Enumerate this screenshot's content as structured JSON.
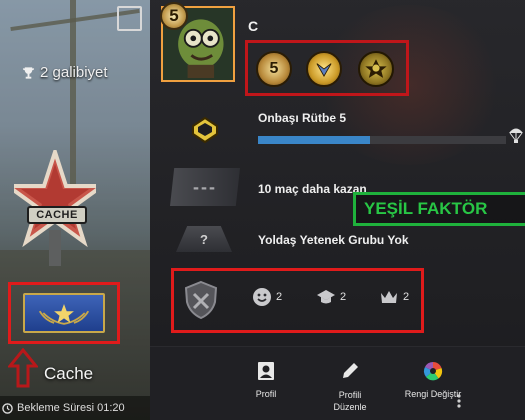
{
  "left_panel": {
    "wins_text": "2 galibiyet",
    "map_badge_text": "CACHE",
    "map_name": "Cache",
    "wait_label": "Bekleme Süresi 01:20"
  },
  "profile": {
    "level": "5",
    "username": "C",
    "rank_name": "Onbaşı Rütbe 5",
    "xp_progress": 0.45,
    "wins_placeholder": "---",
    "wins_needed_text": "10 maç daha kazan",
    "skill_placeholder": "?",
    "skill_group_text": "Yoldaş Yetenek Grubu Yok",
    "annotation_text": "YEŞİL FAKTÖR",
    "coin_labels": [
      "5",
      "",
      ""
    ],
    "commends": [
      {
        "icon": "smile-icon",
        "count": "2"
      },
      {
        "icon": "graduation-cap-icon",
        "count": "2"
      },
      {
        "icon": "crown-icon",
        "count": "2"
      }
    ]
  },
  "actions": [
    {
      "label": "Profil",
      "icon": "profile-icon"
    },
    {
      "label": "Profili Düzenle",
      "icon": "pencil-icon"
    },
    {
      "label": "Rengi Değiştir",
      "icon": "color-wheel-icon"
    }
  ],
  "colors": {
    "annotation_red": "#e01b1b",
    "annotation_green": "#1fb23c",
    "xp_blue": "#3a86c8",
    "avatar_border": "#f0a040"
  }
}
